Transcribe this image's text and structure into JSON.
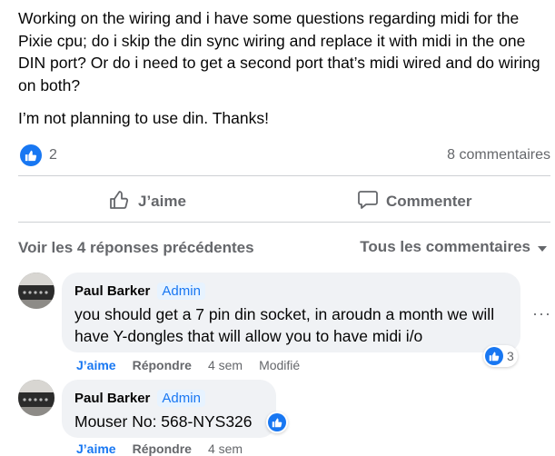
{
  "post": {
    "paragraphs": [
      "Working on the wiring and i have some questions regarding midi for the Pixie cpu; do i skip the din sync wiring and replace it with midi in the one DIN port? Or do i need to get a second port that’s midi wired and do wiring on both?",
      "I’m not planning to use din. Thanks!"
    ],
    "reaction_count": "2",
    "comment_count": "8 commentaires"
  },
  "actions": {
    "like_label": "J’aime",
    "comment_label": "Commenter"
  },
  "comments_header": {
    "previous_label": "Voir les 4 réponses précédentes",
    "filter_label": "Tous les commentaires"
  },
  "comments": [
    {
      "author": "Paul Barker",
      "badge": "Admin",
      "text": "you should get a 7 pin din socket, in aroudn a month we will have Y-dongles that will allow you to have midi i/o",
      "like_label": "J’aime",
      "reply_label": "Répondre",
      "age": "4 sem",
      "edited_label": "Modifié",
      "reaction_count": "3"
    },
    {
      "author": "Paul Barker",
      "badge": "Admin",
      "text": "Mouser No: 568-NYS326",
      "like_label": "J’aime",
      "reply_label": "Répondre",
      "age": "4 sem"
    }
  ],
  "colors": {
    "accent": "#1877f2",
    "muted": "#65676b",
    "bubble": "#f0f2f5"
  },
  "icons": [
    "like-icon",
    "like-outline-icon",
    "comment-icon",
    "caret-down-icon",
    "more-icon"
  ]
}
